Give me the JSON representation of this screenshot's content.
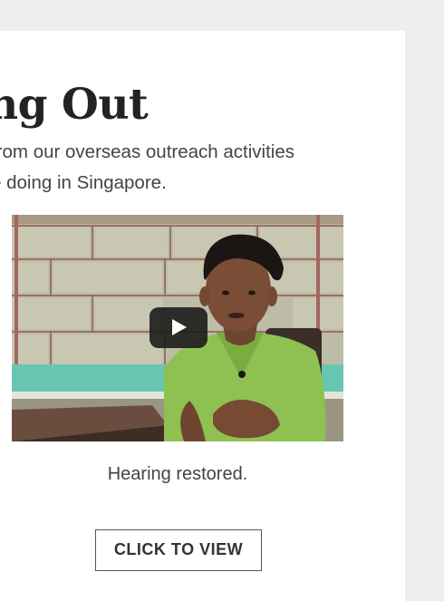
{
  "section": {
    "title": "ng Out",
    "description_lines": [
      "from our overseas outreach activities",
      "e doing in Singapore."
    ]
  },
  "video": {
    "caption": "Hearing restored.",
    "play_icon": "play-icon"
  },
  "cta": {
    "label": "CLICK TO VIEW"
  },
  "colors": {
    "page_background": "#eeeeee",
    "card_background": "#ffffff",
    "title_text": "#232323",
    "body_text": "#444444",
    "play_button": "#1c1c1c"
  }
}
